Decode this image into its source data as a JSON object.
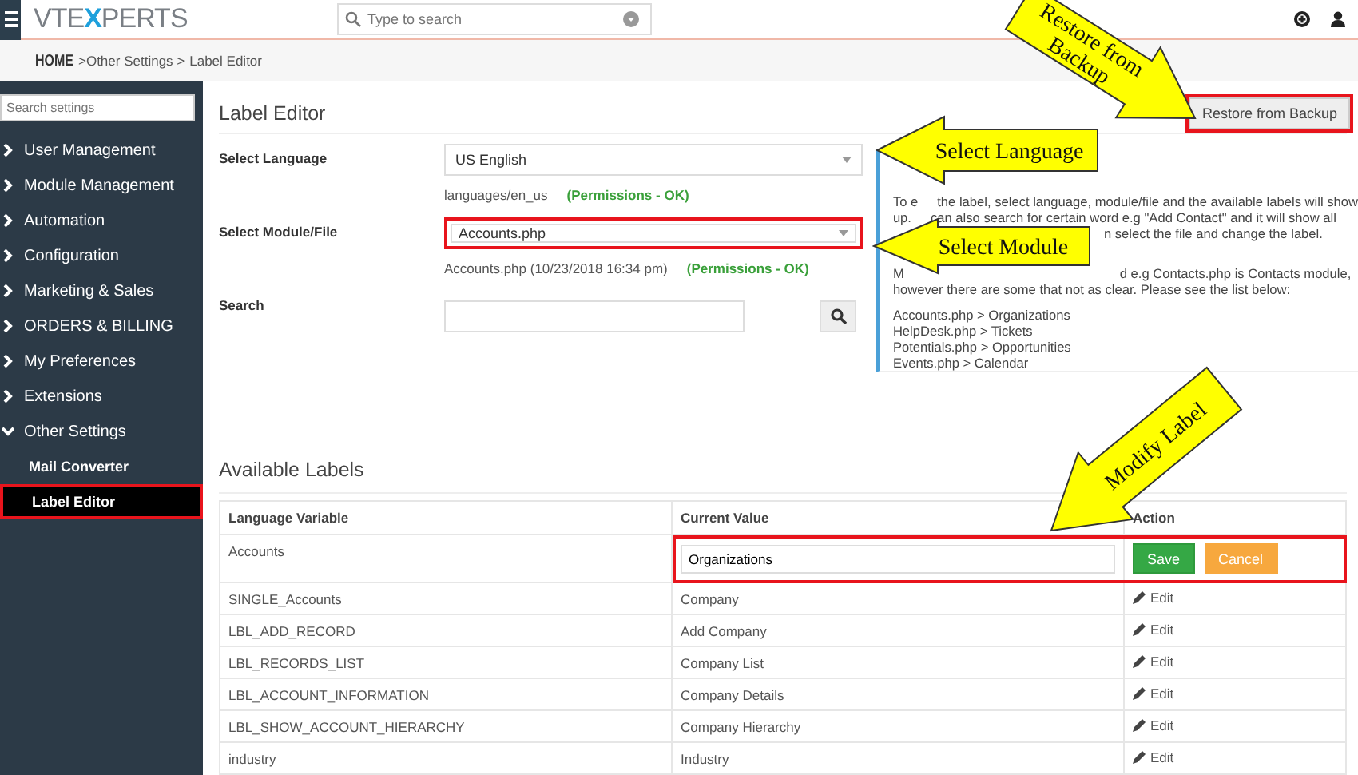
{
  "topbar": {
    "logo": {
      "before": "VTE",
      "accent": "X",
      "after": "PERTS"
    },
    "search": {
      "placeholder": "Type to search"
    }
  },
  "breadcrumb": [
    {
      "label": "HOME",
      "kind": "home"
    },
    {
      "label": ">Other Settings >",
      "kind": "link"
    },
    {
      "label": "Label Editor",
      "kind": "current"
    }
  ],
  "sidebar": {
    "search": {
      "placeholder": "Search settings"
    },
    "items": [
      {
        "label": "User Management",
        "expanded": false
      },
      {
        "label": "Module Management",
        "expanded": false
      },
      {
        "label": "Automation",
        "expanded": false
      },
      {
        "label": "Configuration",
        "expanded": false
      },
      {
        "label": "Marketing & Sales",
        "expanded": false
      },
      {
        "label": "ORDERS & BILLING",
        "expanded": false
      },
      {
        "label": "My Preferences",
        "expanded": false
      },
      {
        "label": "Extensions",
        "expanded": false
      },
      {
        "label": "Other Settings",
        "expanded": true,
        "children": [
          {
            "label": "Mail Converter",
            "selected": false,
            "highlighted": false
          },
          {
            "label": "Label Editor",
            "selected": true,
            "highlighted": true
          }
        ]
      }
    ]
  },
  "page": {
    "title": "Label Editor",
    "restore_button": {
      "label": "Restore from Backup",
      "highlighted": true
    },
    "form": [
      {
        "label": "Select Language",
        "kind": "select",
        "value": "US English",
        "highlighted": false,
        "path": "languages/en_us",
        "status": "(Permissions - OK)"
      },
      {
        "label": "Select Module/File",
        "kind": "select",
        "value": "Accounts.php",
        "highlighted": true,
        "path": "Accounts.php (10/23/2018 16:34 pm)",
        "status": "(Permissions - OK)"
      },
      {
        "label": "Search",
        "kind": "search"
      }
    ],
    "info": {
      "lines": [
        [
          "To e",
          "the label, select language, module/file and the available labels will show"
        ],
        [
          "up.",
          "can also search for certain word e.g \"Add Contact\" and it will show all"
        ],
        [
          "n select the file and change the label."
        ],
        [
          "M",
          "d e.g Contacts.php is Contacts module,"
        ],
        [
          "however there are some that not as clear. Please see the list below:"
        ],
        [
          "Accounts.php > Organizations"
        ],
        [
          "HelpDesk.php > Tickets"
        ],
        [
          "Potentials.php > Opportunities"
        ],
        [
          "Events.php > Calendar"
        ]
      ]
    },
    "labels_title": "Available Labels",
    "table": {
      "columns": [
        "Language Variable",
        "Current Value",
        "Action"
      ],
      "rows": [
        {
          "kind": "editing",
          "variable": "Accounts",
          "value": "Organizations",
          "save": "Save",
          "cancel": "Cancel",
          "highlighted": true
        },
        {
          "kind": "view",
          "variable": "SINGLE_Accounts",
          "value": "Company",
          "action": "Edit"
        },
        {
          "kind": "view",
          "variable": "LBL_ADD_RECORD",
          "value": "Add Company",
          "action": "Edit"
        },
        {
          "kind": "view",
          "variable": "LBL_RECORDS_LIST",
          "value": "Company List",
          "action": "Edit"
        },
        {
          "kind": "view",
          "variable": "LBL_ACCOUNT_INFORMATION",
          "value": "Company Details",
          "action": "Edit"
        },
        {
          "kind": "view",
          "variable": "LBL_SHOW_ACCOUNT_HIERARCHY",
          "value": "Company Hierarchy",
          "action": "Edit"
        },
        {
          "kind": "view",
          "variable": "industry",
          "value": "Industry",
          "action": "Edit"
        }
      ]
    }
  },
  "callouts": [
    {
      "lines": [
        "Restore from",
        "Backup"
      ]
    },
    {
      "lines": [
        "Select Language"
      ]
    },
    {
      "lines": [
        "Select Module"
      ]
    },
    {
      "lines": [
        "Modify Label"
      ]
    }
  ]
}
